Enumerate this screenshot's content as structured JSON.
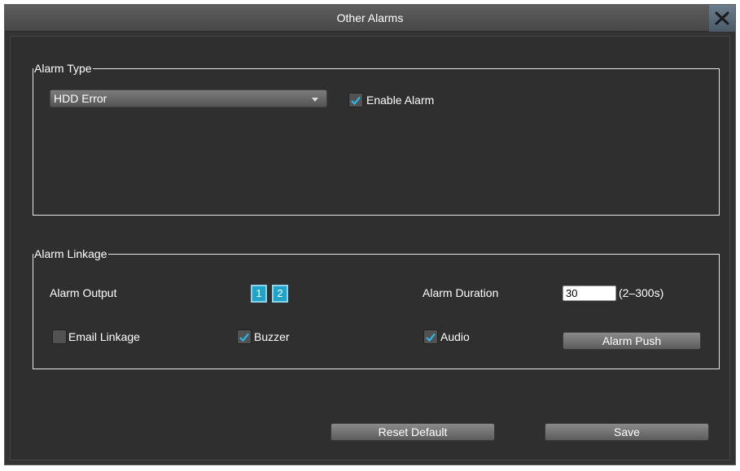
{
  "window": {
    "title": "Other Alarms",
    "close_icon": "close-x-icon"
  },
  "alarm_type": {
    "legend": "Alarm Type",
    "select_value": "HDD Error",
    "enable_alarm_label": "Enable Alarm",
    "enable_alarm_checked": true
  },
  "alarm_linkage": {
    "legend": "Alarm Linkage",
    "alarm_output_label": "Alarm Output",
    "outputs": [
      "1",
      "2"
    ],
    "alarm_duration_label": "Alarm Duration",
    "alarm_duration_value": "30",
    "alarm_duration_range": "(2–300s)",
    "email_linkage_label": "Email Linkage",
    "email_linkage_checked": false,
    "buzzer_label": "Buzzer",
    "buzzer_checked": true,
    "audio_label": "Audio",
    "audio_checked": true,
    "alarm_push_label": "Alarm Push"
  },
  "footer": {
    "reset_label": "Reset Default",
    "save_label": "Save"
  },
  "colors": {
    "accent": "#1fa3c9",
    "checkmark": "#29b6e8",
    "background": "#333333"
  }
}
